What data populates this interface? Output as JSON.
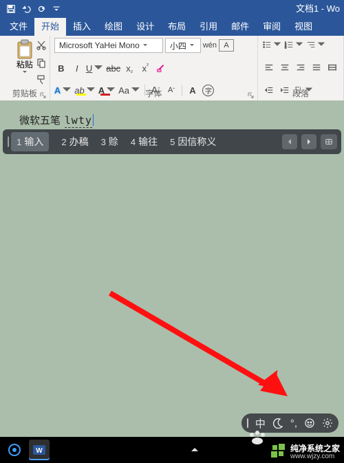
{
  "title": "文档1 - Wo",
  "tabs": [
    "文件",
    "开始",
    "插入",
    "绘图",
    "设计",
    "布局",
    "引用",
    "邮件",
    "审阅",
    "视图"
  ],
  "active_tab": 1,
  "groups": {
    "clipboard": "剪贴板",
    "font": "字体",
    "paragraph": "段落"
  },
  "clipboard": {
    "paste": "粘贴"
  },
  "font": {
    "name": "Microsoft YaHei Mono",
    "size": "小四",
    "wen": "wén",
    "A_box": "A"
  },
  "doc": {
    "committed": "微软五笔",
    "composing": "lwty"
  },
  "ime": {
    "candidates": [
      {
        "n": "1",
        "t": "输入"
      },
      {
        "n": "2",
        "t": "办稿"
      },
      {
        "n": "3",
        "t": "赊"
      },
      {
        "n": "4",
        "t": "输往"
      },
      {
        "n": "5",
        "t": "因信称义"
      }
    ]
  },
  "ime_status": {
    "lang": "中",
    "punct": "°,"
  },
  "watermark": {
    "name": "纯净系统之家",
    "url": "www.wjzy.com"
  }
}
